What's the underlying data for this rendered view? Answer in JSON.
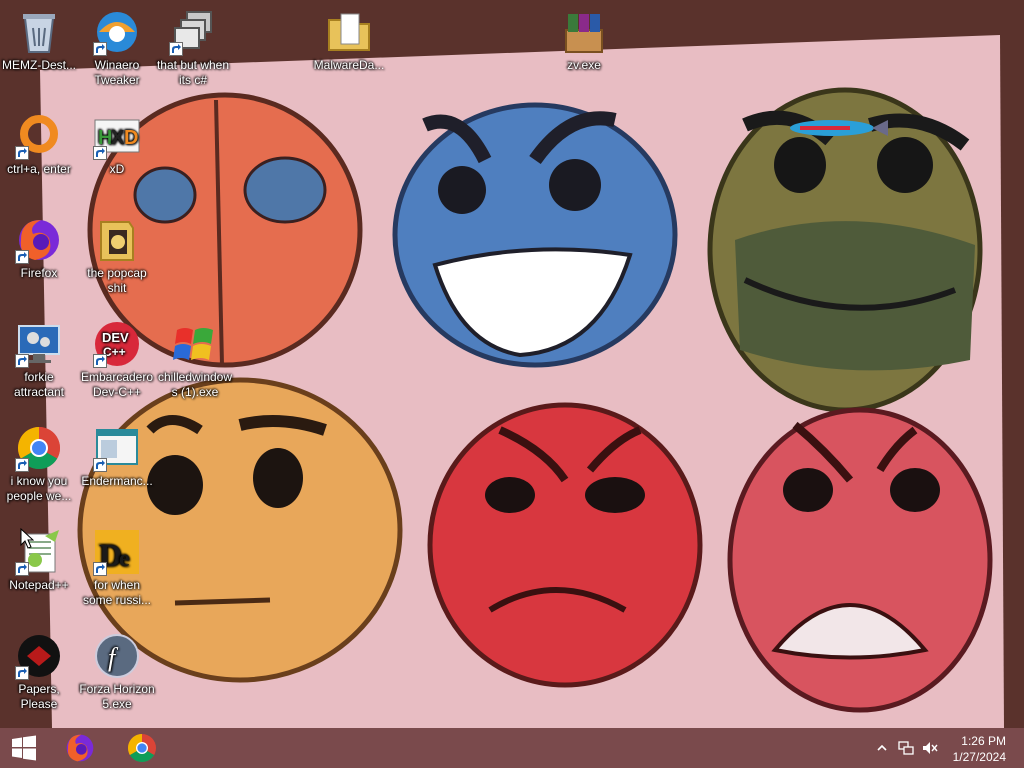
{
  "desktop": {
    "icons": [
      {
        "label": "MEMZ-Dest...",
        "icon": "recycle-bin-icon"
      },
      {
        "label": "Winaero Tweaker",
        "icon": "winaero-icon"
      },
      {
        "label": "that but when its c#",
        "icon": "stacked-windows-icon"
      },
      {
        "label": "MalwareDa...",
        "icon": "folder-icon"
      },
      {
        "label": "zv.exe",
        "icon": "winrar-box-icon"
      },
      {
        "label": "ctrl+a, enter",
        "icon": "orange-ring-icon"
      },
      {
        "label": "xD",
        "icon": "hxd-icon"
      },
      {
        "label": "Firefox",
        "icon": "firefox-icon"
      },
      {
        "label": "the popcap shit",
        "icon": "popcap-icon"
      },
      {
        "label": "forkie attractant",
        "icon": "monitor-gear-icon"
      },
      {
        "label": "Embarcadero Dev-C++",
        "icon": "devcpp-icon"
      },
      {
        "label": "chilledwindows (1).exe",
        "icon": "windows-xp-flag-icon"
      },
      {
        "label": "i know you people we...",
        "icon": "chrome-icon"
      },
      {
        "label": "Endermanc...",
        "icon": "window-app-icon"
      },
      {
        "label": "Notepad++",
        "icon": "notepadpp-icon"
      },
      {
        "label": "for when some russi...",
        "icon": "de-icon"
      },
      {
        "label": "Papers, Please",
        "icon": "papers-please-icon"
      },
      {
        "label": "Forza Horizon 5.exe",
        "icon": "flash-icon"
      }
    ]
  },
  "taskbar": {
    "start": "windows-start-icon",
    "pinned": [
      "firefox-icon",
      "chrome-icon"
    ],
    "tray": {
      "time": "1:26 PM",
      "date": "1/27/2024",
      "icons": [
        "chevron-up-icon",
        "network-icon",
        "volume-muted-icon"
      ]
    }
  },
  "colors": {
    "taskbar": "#7a4a4c",
    "paper": "#e9bfc4"
  }
}
